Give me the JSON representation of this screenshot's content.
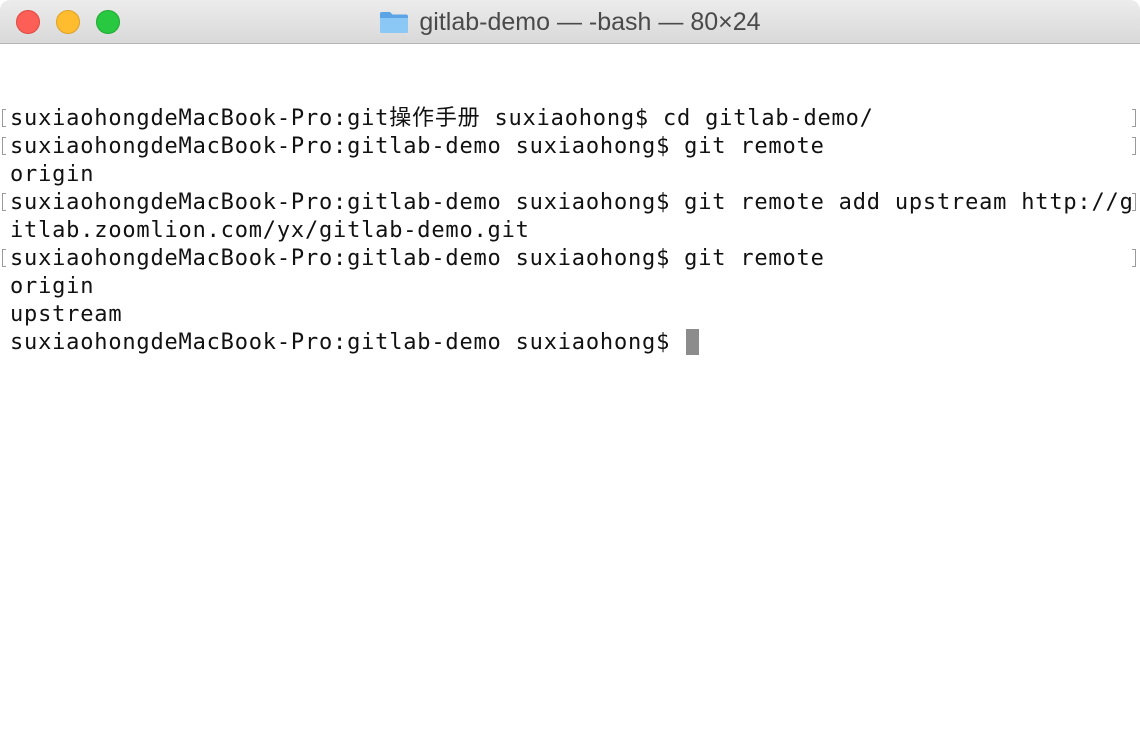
{
  "window": {
    "title": "gitlab-demo — -bash — 80×24",
    "controls": {
      "close": "close",
      "minimize": "minimize",
      "zoom": "zoom"
    },
    "folder_icon": "folder-icon",
    "folder_color": "#6cb4ee"
  },
  "terminal": {
    "lines": [
      {
        "text": "suxiaohongdeMacBook-Pro:git操作手册 suxiaohong$ cd gitlab-demo/",
        "marked": true
      },
      {
        "text": "suxiaohongdeMacBook-Pro:gitlab-demo suxiaohong$ git remote",
        "marked": true
      },
      {
        "text": "origin",
        "marked": false
      },
      {
        "text": "suxiaohongdeMacBook-Pro:gitlab-demo suxiaohong$ git remote add upstream http://g",
        "marked": true
      },
      {
        "text": "itlab.zoomlion.com/yx/gitlab-demo.git",
        "marked": false
      },
      {
        "text": "suxiaohongdeMacBook-Pro:gitlab-demo suxiaohong$ git remote",
        "marked": true
      },
      {
        "text": "origin",
        "marked": false
      },
      {
        "text": "upstream",
        "marked": false
      },
      {
        "text": "suxiaohongdeMacBook-Pro:gitlab-demo suxiaohong$ ",
        "marked": false
      }
    ],
    "cursor_color": "#8c8c8c"
  }
}
